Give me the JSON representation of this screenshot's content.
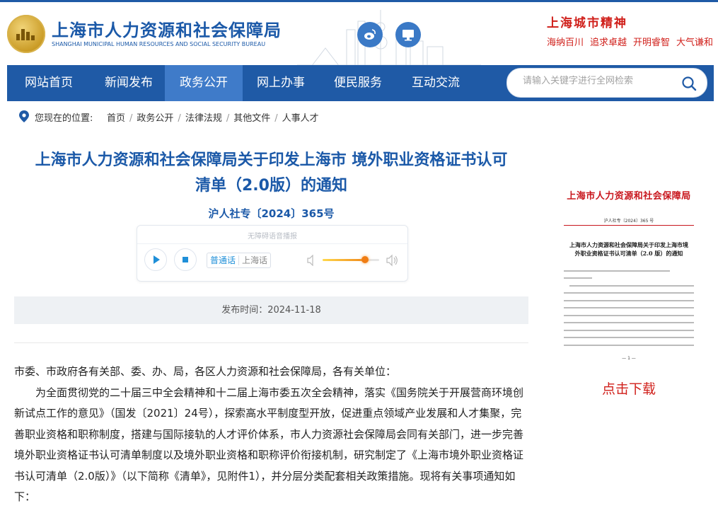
{
  "header": {
    "site_name_cn": "上海市人力资源和社会保障局",
    "site_name_en": "SHANGHAI MUNICIPAL HUMAN RESOURCES AND SOCIAL SECURITY BUREAU",
    "spirit_title": "上海城市精神",
    "spirit_items": [
      "海纳百川",
      "追求卓越",
      "开明睿智",
      "大气谦和"
    ]
  },
  "nav": {
    "items": [
      "网站首页",
      "新闻发布",
      "政务公开",
      "网上办事",
      "便民服务",
      "互动交流"
    ],
    "active_index": 2
  },
  "search": {
    "placeholder": "请输入关键字进行全网检索"
  },
  "breadcrumb": {
    "label": "您现在的位置:",
    "items": [
      "首页",
      "政务公开",
      "法律法规",
      "其他文件",
      "人事人才"
    ]
  },
  "article": {
    "title_line1": "上海市人力资源和社会保障局关于印发上海市 境外职业资格证书认可",
    "title_line2": "清单（2.0版）的通知",
    "doc_number": "沪人社专〔2024〕365号",
    "publish_label": "发布时间：2024-11-18",
    "body": [
      "市委、市政府各有关部、委、办、局，各区人力资源和社会保障局，各有关单位：",
      "为全面贯彻党的二十届三中全会精神和十二届上海市委五次全会精神，落实《国务院关于开展营商环境创新试点工作的意见》（国发〔2021〕24号），探索高水平制度型开放，促进重点领域产业发展和人才集聚，完善职业资格和职称制度，搭建与国际接轨的人才评价体系，市人力资源社会保障局会同有关部门，进一步完善境外职业资格证书认可清单制度以及境外职业资格和职称评价衔接机制，研究制定了《上海市境外职业资格证书认可清单（2.0版）》（以下简称《清单》，见附件1），并分层分类配套相关政策措施。现将有关事项通知如下："
    ]
  },
  "player": {
    "title": "无障碍语音播报",
    "lang_active": "普通话",
    "lang_other": "上海话",
    "volume": 0.75
  },
  "preview": {
    "head": "上海市人力资源和社会保障局",
    "doc_number": "沪人社专〔2024〕365 号",
    "title": "上海市人力资源和社会保障局关于印发上海市境外职业资格证书认可清单（2.0 版）的通知",
    "page": "— 1 —",
    "download": "点击下载"
  },
  "colors": {
    "brand_blue": "#1f5aa6",
    "title_blue": "#1b59a8",
    "accent_red": "#d0201b"
  }
}
